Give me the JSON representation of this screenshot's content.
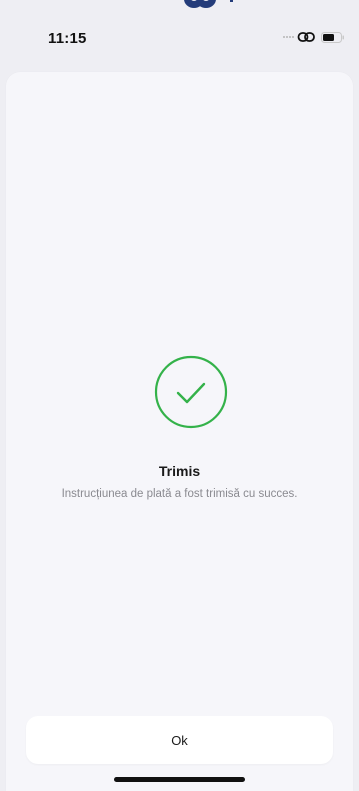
{
  "status_bar": {
    "time": "11:15",
    "icons": [
      "signal-dots-icon",
      "link-icon",
      "battery-icon"
    ]
  },
  "top_logo": {
    "icon": "bank-logo-icon"
  },
  "result": {
    "icon": "checkmark-circle-icon",
    "title": "Trimis",
    "message": "Instrucțiunea de plată a fost trimisă cu succes."
  },
  "actions": {
    "ok_label": "Ok"
  },
  "colors": {
    "success_green": "#34b24a",
    "background": "#eeeef3",
    "sheet": "#f6f6fa",
    "button": "#ffffff"
  }
}
